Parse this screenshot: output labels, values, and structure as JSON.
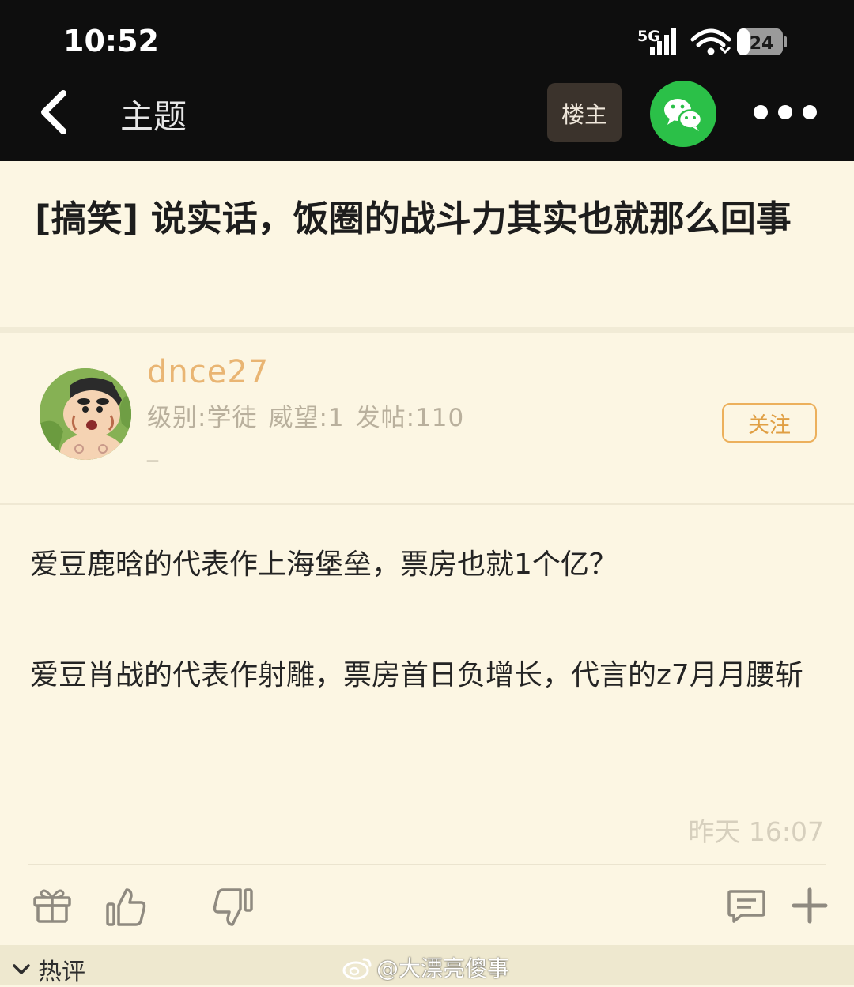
{
  "status_bar": {
    "time": "10:52",
    "network": "5G",
    "battery": "24"
  },
  "nav": {
    "title": "主题",
    "op_button": "楼主",
    "share_icon": "wechat-icon",
    "more_icon": "more-icon",
    "back_icon": "back-icon"
  },
  "post": {
    "title": "[搞笑] 说实话，饭圈的战斗力其实也就那么回事",
    "author": {
      "name": "dnce27",
      "level": "级别:学徒",
      "prestige": "威望:1",
      "posts": "发帖:110",
      "extra": "_",
      "follow_label": "关注"
    },
    "paragraphs": [
      "爱豆鹿晗的代表作上海堡垒，票房也就1个亿？",
      "爱豆肖战的代表作射雕，票房首日负增长，代言的z7月月腰斩"
    ],
    "timestamp": "昨天 16:07"
  },
  "actions": {
    "gift": "gift-icon",
    "like": "thumbs-up-icon",
    "dislike": "thumbs-down-icon",
    "comment": "comment-icon",
    "add": "plus-icon"
  },
  "bottom": {
    "hot_label": "热评",
    "watermark": "@大漂亮傻事"
  },
  "colors": {
    "background": "#fcf6e3",
    "nav_bg": "#0e0e0e",
    "username": "#e9b573",
    "follow": "#e09f43",
    "wechat": "#2bc048"
  }
}
